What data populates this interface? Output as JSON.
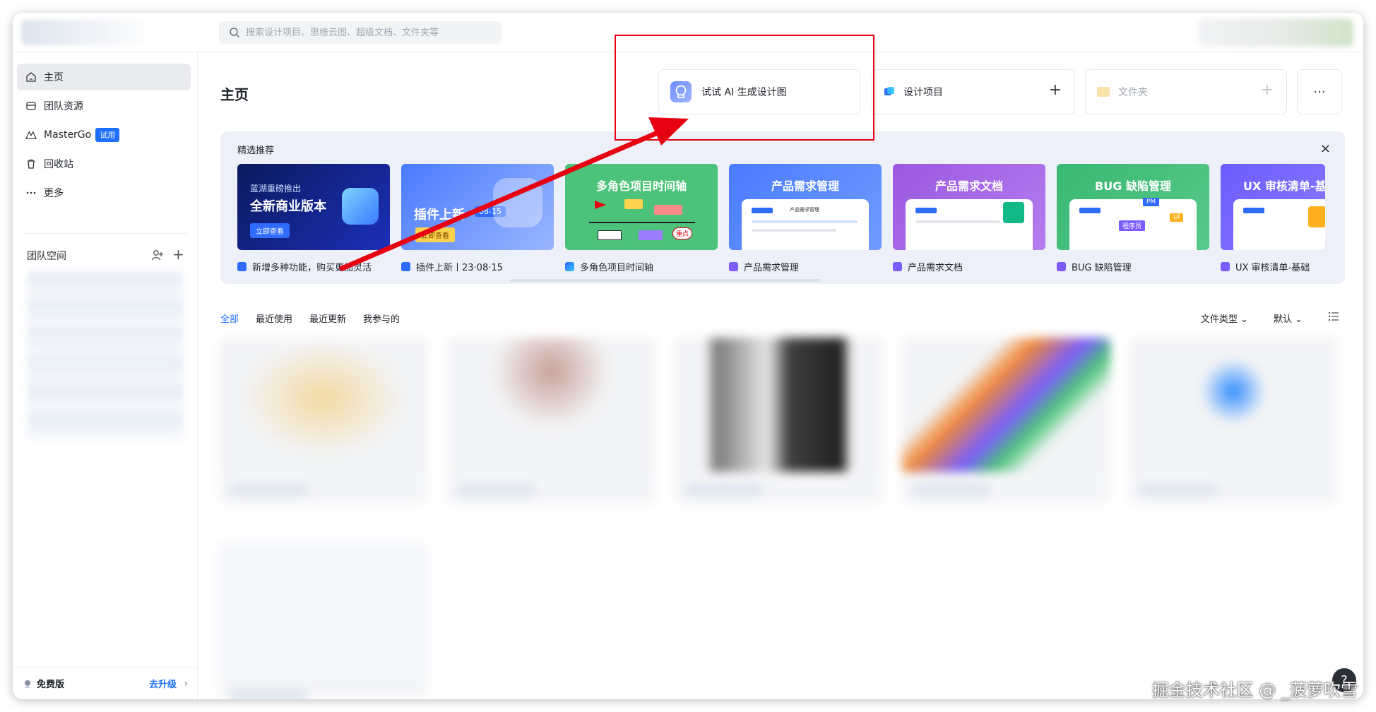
{
  "search": {
    "placeholder": "搜索设计项目、思维云图、超级文档、文件夹等"
  },
  "sidebar": {
    "items": [
      {
        "label": "主页",
        "icon": "home-icon"
      },
      {
        "label": "团队资源",
        "icon": "team-resource-icon"
      },
      {
        "label": "MasterGo",
        "icon": "mastergo-logo-icon",
        "badge": "试用"
      },
      {
        "label": "回收站",
        "icon": "trash-icon"
      },
      {
        "label": "更多",
        "icon": "more-dots-icon"
      }
    ],
    "team_space_title": "团队空间",
    "plan": "免费版",
    "upgrade": "去升级"
  },
  "main": {
    "title": "主页",
    "actions": {
      "ai": "试试 AI 生成设计图",
      "design": "设计项目",
      "folder": "文件夹",
      "more": "···"
    },
    "featured": {
      "title": "精选推荐",
      "close": "×",
      "cards": [
        {
          "kicker": "蓝湖重磅推出",
          "title": "全新商业版本",
          "cta": "立即查看",
          "label": "新增多种功能，购买更加灵活"
        },
        {
          "title": "插件上新",
          "badge": "08-15",
          "cta": "立即查看",
          "label": "插件上新丨23·08·15"
        },
        {
          "title": "多角色项目时间轴",
          "stamp": "重点",
          "label": "多角色项目时间轴"
        },
        {
          "title": "产品需求管理",
          "mock_caption": "产品需求管理",
          "label": "产品需求管理"
        },
        {
          "title": "产品需求文档",
          "label": "产品需求文档"
        },
        {
          "title": "BUG 缺陷管理",
          "tag_pm": "PM",
          "tag_dev": "程序员",
          "tag_ui": "UI",
          "label": "BUG 缺陷管理"
        },
        {
          "title": "UX 审核清单-基",
          "label": "UX 审核清单-基础"
        }
      ]
    },
    "tabs": [
      "全部",
      "最近使用",
      "最近更新",
      "我参与的"
    ],
    "filters": {
      "type": "文件类型",
      "sort": "默认"
    }
  },
  "help": "?",
  "watermark": "掘金技术社区 @ _菠萝吹雪",
  "colors": {
    "accent": "#1f6fff",
    "annotation": "#e60012"
  }
}
